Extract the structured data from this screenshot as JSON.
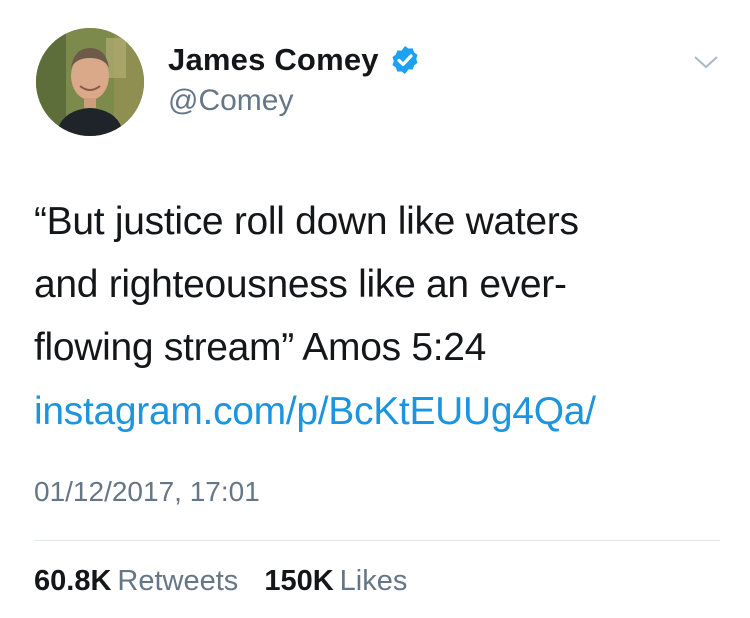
{
  "author": {
    "display_name": "James Comey",
    "handle": "@Comey",
    "verified": true,
    "verified_color": "#1da1f2"
  },
  "tweet": {
    "text_lines": [
      "“But justice roll down like waters",
      "and righteousness like an ever-",
      "flowing stream” Amos 5:24"
    ],
    "link": "instagram.com/p/BcKtEUUg4Qa/",
    "link_color": "#1b95e0",
    "timestamp": "01/12/2017, 17:01"
  },
  "stats": {
    "retweets_count": "60.8K",
    "retweets_label": "Retweets",
    "likes_count": "150K",
    "likes_label": "Likes"
  },
  "icons": {
    "menu": "chevron-down-icon",
    "verified": "verified-badge-icon"
  }
}
